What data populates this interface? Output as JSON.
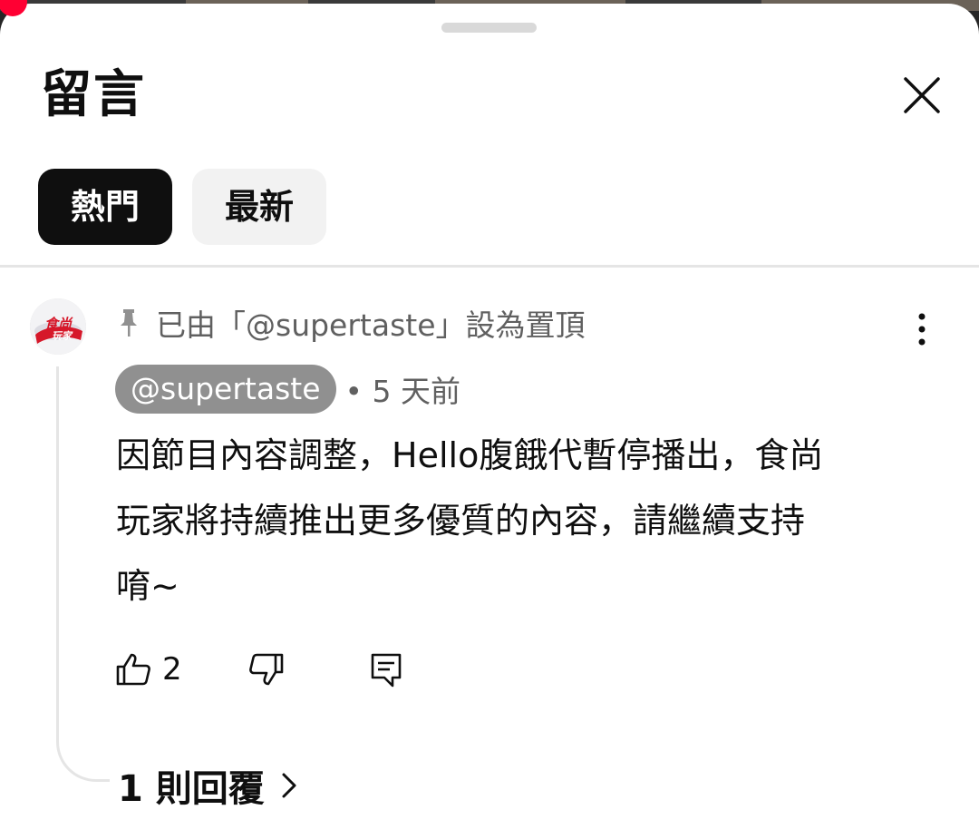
{
  "colors": {
    "accent_dark": "#0f0f0f",
    "chip_inactive_bg": "#f2f2f2",
    "secondary_text": "#606060",
    "author_chip_bg": "#909090",
    "notification_dot": "#ff0033"
  },
  "sheet": {
    "title": "留言",
    "close_icon": "close-icon"
  },
  "tabs": [
    {
      "label": "熱門",
      "selected": true
    },
    {
      "label": "最新",
      "selected": false
    }
  ],
  "comment": {
    "avatar_logo_text": "食尚玩家",
    "pinned_label": "已由「@supertaste」設為置頂",
    "author": "@supertaste",
    "time": "• 5 天前",
    "lines": [
      "因節目內容調整，Hello腹餓代暫停播出，食尚",
      "玩家將持續推出更多優質的內容，請繼續支持",
      "唷~"
    ],
    "like_count": "2",
    "icons": [
      "pin-icon",
      "more-vert-icon",
      "thumb-up-icon",
      "thumb-down-icon",
      "reply-icon",
      "chevron-right-icon"
    ]
  },
  "replies": {
    "label": "1 則回覆"
  }
}
